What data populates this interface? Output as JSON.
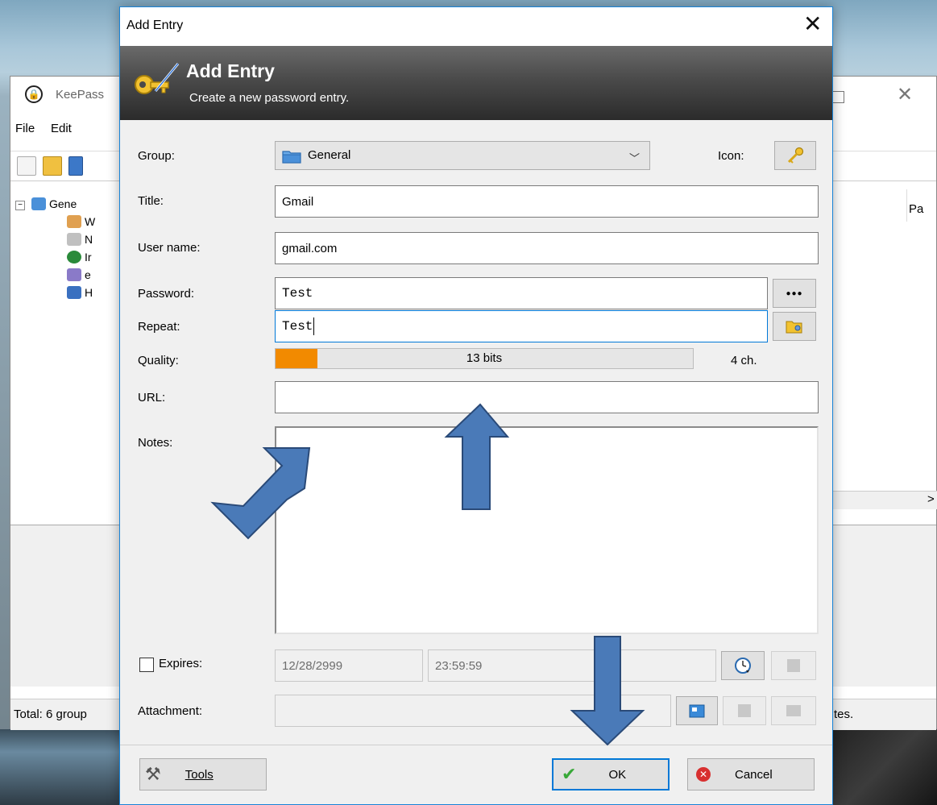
{
  "background_window": {
    "title": "KeePass",
    "menu": [
      "File",
      "Edit"
    ],
    "tree": [
      {
        "label": "Gene",
        "icon": "folder-icon"
      },
      {
        "label": "W",
        "icon": "windows-icon"
      },
      {
        "label": "N",
        "icon": "network-icon"
      },
      {
        "label": "Ir",
        "icon": "internet-icon"
      },
      {
        "label": "e",
        "icon": "email-icon"
      },
      {
        "label": "H",
        "icon": "homebanking-icon"
      }
    ],
    "list_header": "Pa",
    "scroll_arrow": ">",
    "status_left": "Total: 6 group",
    "status_right": "tes."
  },
  "dialog": {
    "window_title": "Add Entry",
    "close": "✕",
    "banner_title": "Add Entry",
    "banner_subtitle": "Create a new password entry.",
    "labels": {
      "group": "Group:",
      "icon": "Icon:",
      "title": "Title:",
      "username": "User name:",
      "password": "Password:",
      "repeat": "Repeat:",
      "quality": "Quality:",
      "url": "URL:",
      "notes": "Notes:",
      "expires": "Expires:",
      "attachment": "Attachment:"
    },
    "values": {
      "group": "General",
      "title": "Gmail",
      "username": "gmail.com",
      "password": "Test",
      "repeat": "Test",
      "url": "",
      "notes": "",
      "expires_date": "12/28/2999",
      "expires_time": "23:59:59",
      "attachment": ""
    },
    "quality": {
      "bits_text": "13 bits",
      "fill_fraction": 0.1,
      "length_text": "4 ch."
    },
    "buttons": {
      "show_password": "●●●",
      "tools": "Tools",
      "ok": "OK",
      "cancel": "Cancel"
    },
    "expires_checked": false
  },
  "colors": {
    "accent": "#0078d7",
    "quality_fill": "#f28a00",
    "annotation_arrow": "#4a7ab8"
  }
}
